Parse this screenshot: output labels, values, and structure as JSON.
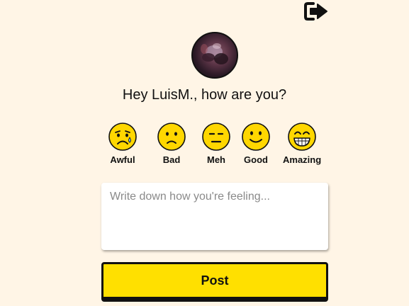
{
  "header": {
    "logout_icon": "sign-out-icon"
  },
  "profile": {
    "avatar_icon": "user-avatar-photo"
  },
  "greeting": "Hey LuisM., how are you?",
  "moods": [
    {
      "label": "Awful",
      "icon": "crying-face-icon"
    },
    {
      "label": "Bad",
      "icon": "frowning-face-icon"
    },
    {
      "label": "Meh",
      "icon": "neutral-face-icon"
    },
    {
      "label": "Good",
      "icon": "smiling-face-icon"
    },
    {
      "label": "Amazing",
      "icon": "grinning-face-icon"
    }
  ],
  "note": {
    "placeholder": "Write down how you're feeling...",
    "value": ""
  },
  "post_label": "Post",
  "colors": {
    "background": "#fff5e6",
    "accent": "#ffe000",
    "emoji": "#ffd700"
  }
}
